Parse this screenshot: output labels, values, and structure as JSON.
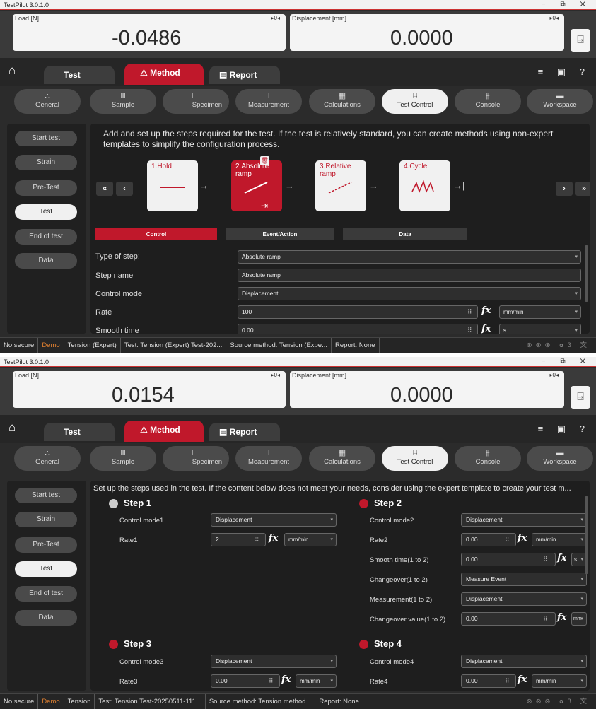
{
  "top": {
    "title": "TestPilot 3.0.1.0",
    "window_controls": "− ⧉ ✕",
    "load_label": "Load [N]",
    "load_value": "-0.0486",
    "disp_label": "Displacement [mm]",
    "disp_value": "0.0000",
    "zero_btn": "▸0◂",
    "tabs": {
      "test": "Test",
      "method": "Method",
      "report": "Report"
    },
    "subnav": [
      "General",
      "Sample",
      "Specimen",
      "Measurement",
      "Calculations",
      "Test Control",
      "Console",
      "Workspace"
    ],
    "side": [
      "Start test",
      "Strain",
      "Pre-Test",
      "Test",
      "End of test",
      "Data"
    ],
    "intro": "Add and set up the steps required for the test. If the test is relatively standard, you can create methods using non-expert templates to simplify the configuration process.",
    "cards": [
      "1.Hold",
      "2.Absolute ramp",
      "3.Relative ramp",
      "4.Cycle"
    ],
    "nav": {
      "first": "«",
      "prev": "‹",
      "next": "›",
      "last": "»"
    },
    "config_tabs": [
      "Control",
      "Event/Action",
      "Data"
    ],
    "fields": [
      {
        "label": "Type of step:",
        "value": "Absolute ramp"
      },
      {
        "label": "Step name",
        "value": "Absolute ramp"
      },
      {
        "label": "Control mode",
        "value": "Displacement"
      },
      {
        "label": "Rate",
        "value": "100",
        "unit": "mm/min"
      },
      {
        "label": "Smooth time",
        "value": "0.00",
        "unit": "s"
      }
    ],
    "status": [
      "No secure",
      "Demo",
      "Tension (Expert)",
      "Test: Tension (Expert) Test-202...",
      "Source method: Tension (Expe...",
      "Report: None"
    ]
  },
  "bottom": {
    "title": "TestPilot 3.0.1.0",
    "load_value": "0.0154",
    "disp_value": "0.0000",
    "intro": "Set up the steps used in the test. If the content below does not meet your needs, consider using the expert template to create your test m...",
    "steps": [
      {
        "title": "Step 1",
        "rows": [
          {
            "label": "Control mode1",
            "value": "Displacement"
          },
          {
            "label": "Rate1",
            "value": "2",
            "unit": "mm/min"
          }
        ]
      },
      {
        "title": "Step 2",
        "rows": [
          {
            "label": "Control mode2",
            "value": "Displacement"
          },
          {
            "label": "Rate2",
            "value": "0.00",
            "unit": "mm/min"
          },
          {
            "label": "Smooth time(1 to 2)",
            "value": "0.00",
            "unit": "s"
          },
          {
            "label": "Changeover(1 to 2)",
            "value": "Measure Event"
          },
          {
            "label": "Measurement(1 to 2)",
            "value": "Displacement"
          },
          {
            "label": "Changeover value(1 to 2)",
            "value": "0.00",
            "unit": "mm"
          }
        ]
      },
      {
        "title": "Step 3",
        "rows": [
          {
            "label": "Control mode3",
            "value": "Displacement"
          },
          {
            "label": "Rate3",
            "value": "0.00",
            "unit": "mm/min"
          }
        ]
      },
      {
        "title": "Step 4",
        "rows": [
          {
            "label": "Control mode4",
            "value": "Displacement"
          },
          {
            "label": "Rate4",
            "value": "0.00",
            "unit": "mm/min"
          }
        ]
      }
    ],
    "status": [
      "No secure",
      "Demo",
      "Tension",
      "Test: Tension Test-20250511-111...",
      "Source method: Tension method...",
      "Report: None"
    ]
  },
  "colors": {
    "accent": "#c0182b",
    "warning": "#e08030"
  }
}
